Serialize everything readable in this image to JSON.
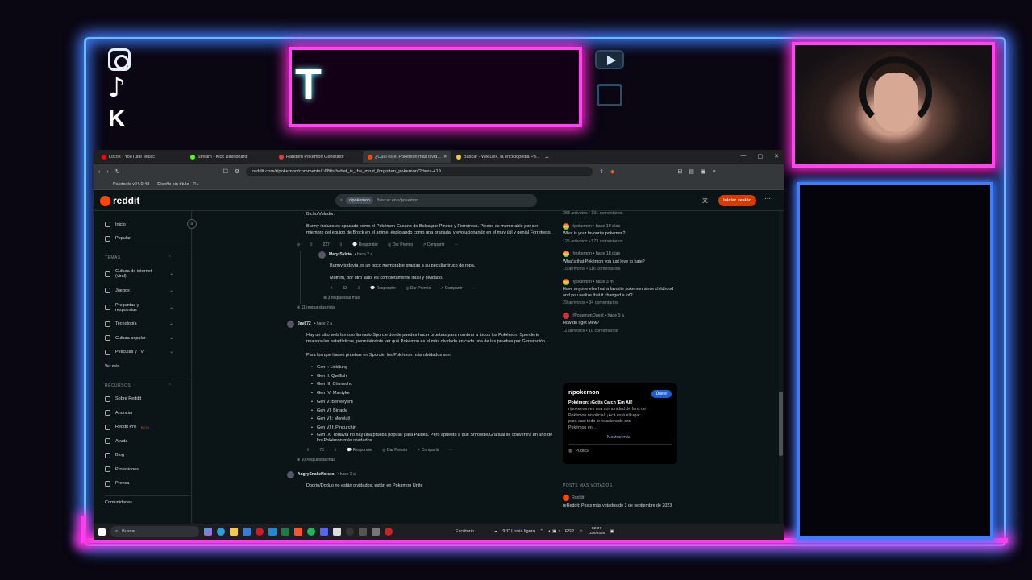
{
  "overlay": {
    "title_letter": "T"
  },
  "browser": {
    "tabs": [
      {
        "label": "Locos - YouTube Music",
        "color": "#ff0000",
        "active": false
      },
      {
        "label": "Stream - Kick Dashboard",
        "color": "#53fc18",
        "active": false
      },
      {
        "label": "Random Pokemon Generator",
        "color": "#e03c3c",
        "active": false
      },
      {
        "label": "¿Cuál es el Pokémon más olvid...",
        "color": "#ff4500",
        "active": true
      },
      {
        "label": "Buscar - WikiDex, la enciclopedia Po...",
        "color": "#f2c94c",
        "active": false
      }
    ],
    "new_tab": "+",
    "url": "reddit.com/r/pokemon/comments/168ttsf/what_is_the_most_forgotten_pokemon/?tl=es-419",
    "bookmarks": [
      "Paletools v24.0.48",
      "Diseño sin título - P..."
    ]
  },
  "reddit": {
    "logo_text": "reddit",
    "search_chip": "r/pokemon",
    "search_placeholder": "Buscar en r/pokemon",
    "login_label": "Iniciar sesión",
    "nav": [
      {
        "label": "Inicio",
        "icon": "home-icon"
      },
      {
        "label": "Popular",
        "icon": "popular-icon"
      }
    ],
    "topics_heading": "TEMAS",
    "topics": [
      "Cultura de internet (viral)",
      "Juegos",
      "Preguntas y respuestas",
      "Tecnología",
      "Cultura popular",
      "Películas y TV"
    ],
    "see_more": "Ver más",
    "resources_heading": "RECURSOS",
    "resources": [
      "Sobre Reddit",
      "Anunciar",
      "Reddit Pro",
      "Ayuda",
      "Blog",
      "Profesiones",
      "Prensa"
    ],
    "beta_badge": "BETA",
    "communities": "Comunidades"
  },
  "thread": {
    "c1_tail": "Bicho/Volador.",
    "c1_p2": "Burmy incluso es opacado como el Pokémon Gusano de Bolsa por Pineco y Forretress. Pineco es memorable por ser miembro del equipo de Brock en el anime, explotando como una granada, y evolucionando en el muy útil y genial Forretress.",
    "c1_votes": "237",
    "reply_label": "Responder",
    "award_label": "Dar Premio",
    "share_label": "Compartir",
    "c2_author": "Mary-Sylvia",
    "c2_time": "• hace 2 a",
    "c2_p1": "Burmy todavía es un poco memorable gracias a su peculiar truco de ropa.",
    "c2_p2": "Mothim, por otro lado, es completamente inútil y olvidado.",
    "c2_votes": "63",
    "c2_more": "3 respuestas más",
    "c1_more": "11 respuestas más",
    "c3_author": "Jav872",
    "c3_time": "• hace 2 a",
    "c3_p1": "Hay un sitio web famoso llamado Sporcle donde puedes hacer pruebas para nombrar a todos los Pokémon. Sporcle te muestra las estadísticas, permitiéndote ver qué Pokémon es el más olvidado en cada una de las pruebas por Generación.",
    "c3_p2": "Para los que hacen pruebas en Sporcle, los Pokémon más olvidados son:",
    "gens": [
      "Gen I: Lickitung",
      "Gen II: Qwilfish",
      "Gen III: Chimecho",
      "Gen IV: Mantyke",
      "Gen V: Beheeyem",
      "Gen VI: Binacle",
      "Gen VII: Morelull",
      "Gen VIII: Pincurchin",
      "Gen IX: Todavía no hay una prueba popular para Paldea. Pero apuesto a que Shroodle/Grafaiai se convertirá en uno de los Pokémon más olvidados"
    ],
    "c3_votes": "73",
    "c3_more": "10 respuestas más",
    "c4_author": "AngrySnakeNoises",
    "c4_time": "• hace 2 a",
    "c4_p1": "Dodrio/Doduo no están olvidados, están en Pokémon Unite"
  },
  "related": {
    "top_partial": "283 arrivotos • 191 comentarios",
    "posts": [
      {
        "sub": "r/pokemon • hace 10 días",
        "title": "What is your favourite pokemon?",
        "stats": "125 arrivotos • 573 comentarios"
      },
      {
        "sub": "r/pokemon • hace 18 días",
        "title": "What's that Pokémon you just love to hate?",
        "stats": "15 arrivotos • 116 comentarios"
      },
      {
        "sub": "r/pokemon • hace 3 m",
        "title": "Have anyone else had a favorite pokemon since childhood and you realize that it changed a lot?",
        "stats": "29 arrivotos • 34 comentarios"
      },
      {
        "sub": "r/PokemonQuest • hace 5 a",
        "title": "How do I get Mew?",
        "stats": "11 arrivotos • 10 comentarios"
      }
    ],
    "community_name": "r/pokemon",
    "join_label": "Únete",
    "community_title": "Pokémon: ¡Gotta Catch 'Em All!",
    "community_desc": "r/pokemon es una comunidad de fans de Pokémon no oficial. ¡Acá está el lugar para casi todo lo relacionado con Pokémon en...",
    "show_more": "Mostrar más",
    "visibility": "Pública",
    "top_posts_heading": "POSTS MÁS VOTADOS",
    "top_post_sub": "Reddit",
    "top_post_title": "reReddit: Posts más votados de 3 de septiembre de 2023"
  },
  "taskbar": {
    "search_label": "Buscar",
    "desktop_label": "Escritorio",
    "weather": "9°C  Lluvia ligera",
    "lang": "ESP",
    "time": "02:07",
    "date": "10/9/2025"
  }
}
